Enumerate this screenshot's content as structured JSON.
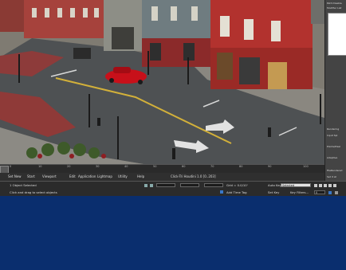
{
  "timeline": {
    "ticks": [
      "0",
      "10",
      "20",
      "30",
      "40",
      "50",
      "60",
      "70",
      "80",
      "90",
      "100"
    ]
  },
  "menu": {
    "items": [
      "Set New",
      "Start",
      "Viewport",
      "Edit",
      "Application",
      "Lightmap",
      "Utility",
      "Help"
    ],
    "center": "Click-Tri Houdini 1.0 [0..203]"
  },
  "status": {
    "selection": "1 Object Selected",
    "prompt": "Click and drag to select objects",
    "grid": "Grid = 0.0/10'",
    "add_time_tag": "Add Time Tag",
    "auto_key": "Auto Key",
    "selected_option": "Selected",
    "set_key": "Set Key",
    "key_filters": "Key Filters...",
    "frame_value": "0"
  },
  "panel": {
    "lines": [
      "Path Disable",
      "Modifier List",
      "Rendering",
      "Input Spl",
      "Points/Pixel",
      "Adaptive",
      "FileRendered",
      "Set it at"
    ]
  },
  "colors": {
    "accent_bg": "#0a2e6e",
    "ui_dark": "#2b2b2b",
    "car": "#c8101a"
  }
}
